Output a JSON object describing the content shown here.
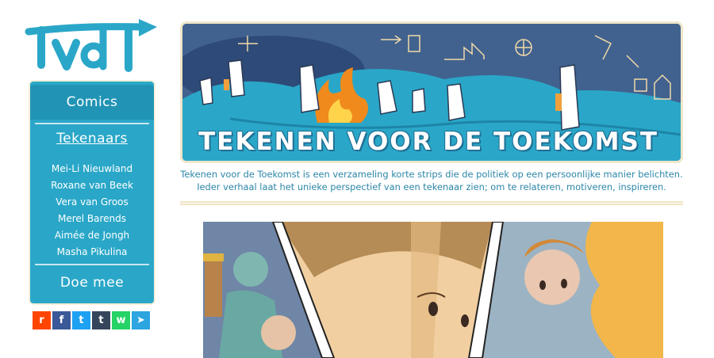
{
  "logo": {
    "text": "tvdt"
  },
  "sidebar": {
    "comics_label": "Comics",
    "tekenaars_label": "Tekenaars",
    "artists": [
      "Mei-Li Nieuwland",
      "Roxane van Beek",
      "Vera van Groos",
      "Merel Barends",
      "Aimée de Jongh",
      "Masha Pikulina"
    ],
    "doe_mee_label": "Doe mee"
  },
  "share": [
    {
      "name": "reddit-icon",
      "glyph": "r",
      "color": "#ff4500"
    },
    {
      "name": "facebook-icon",
      "glyph": "f",
      "color": "#3b5998"
    },
    {
      "name": "twitter-icon",
      "glyph": "t",
      "color": "#1da1f2"
    },
    {
      "name": "tumblr-icon",
      "glyph": "t",
      "color": "#35465c"
    },
    {
      "name": "whatsapp-icon",
      "glyph": "w",
      "color": "#25d366"
    },
    {
      "name": "telegram-icon",
      "glyph": "➤",
      "color": "#2ca5e0"
    }
  ],
  "banner": {
    "title": "TEKENEN VOOR DE TOEKOMST"
  },
  "intro": {
    "line1": "Tekenen voor de Toekomst is een verzameling korte strips die de politiek op een persoonlijke manier belichten.",
    "line2": "Ieder verhaal laat het unieke perspectief van een tekenaar zien; om te relateren, motiveren, inspireren."
  },
  "colors": {
    "accent": "#2aa7c8",
    "accent_dark": "#2194b5",
    "cream": "#f6efd9",
    "text_blue": "#2b86a8"
  }
}
